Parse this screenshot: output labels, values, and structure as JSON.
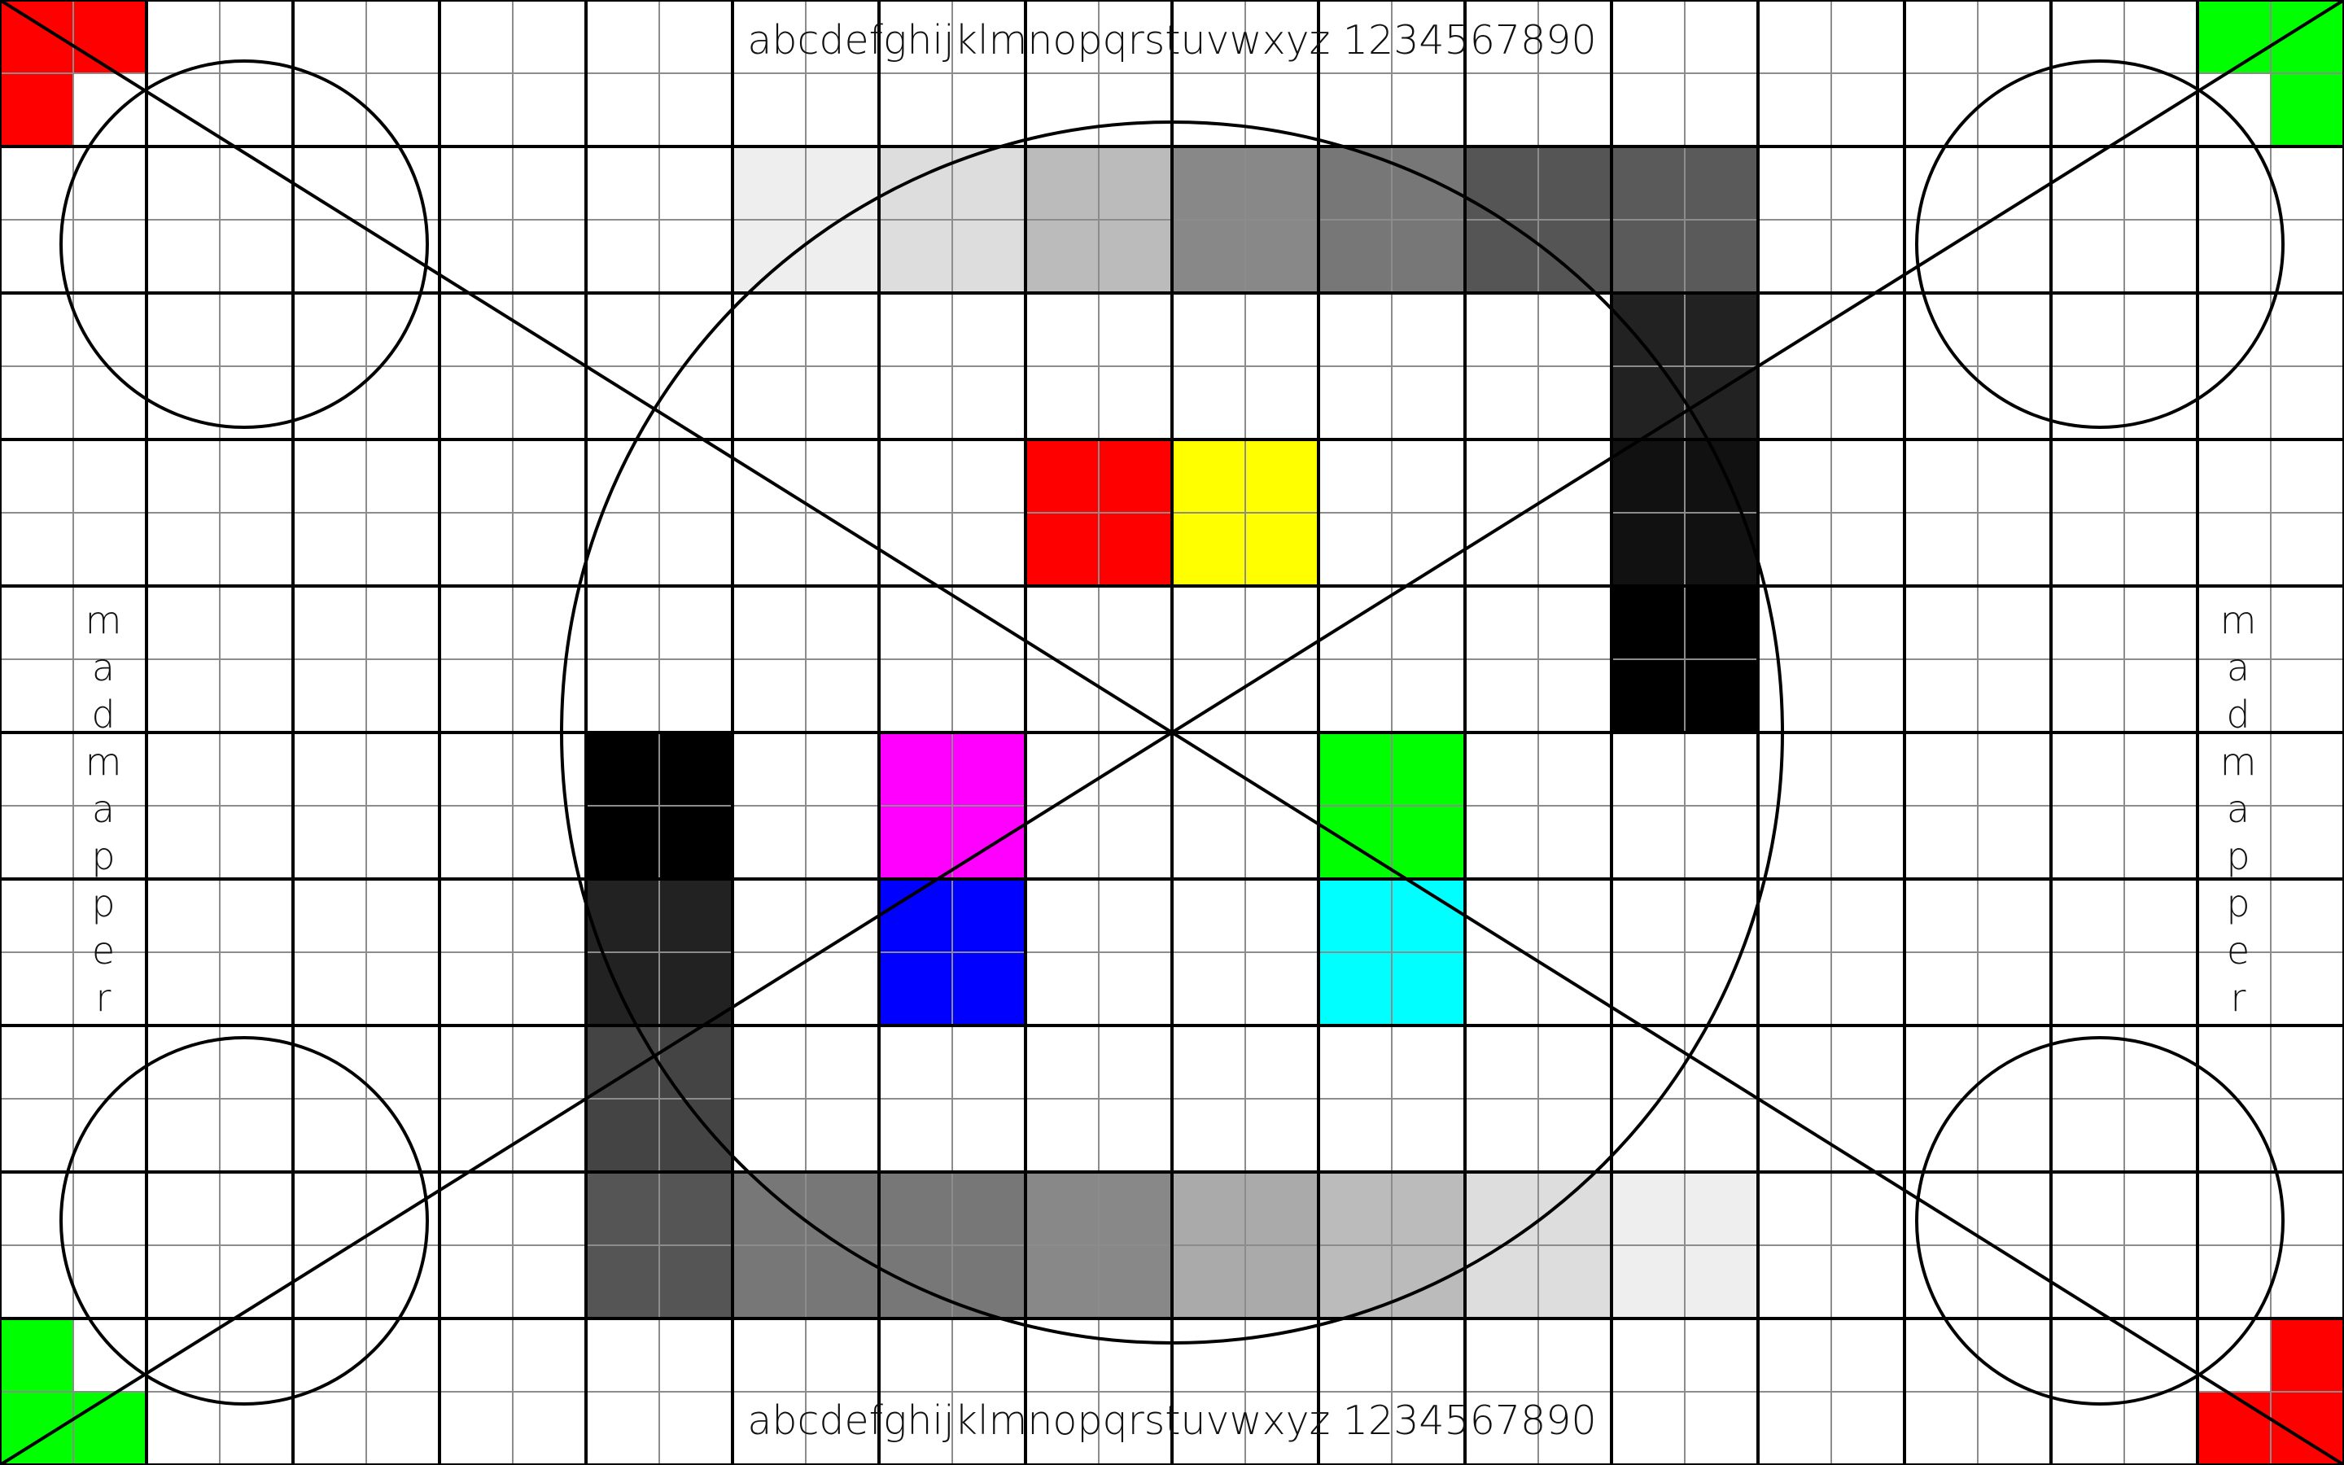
{
  "app": {
    "name": "madmapper"
  },
  "colors": {
    "background": "#ffffff",
    "grid_major": "#000000",
    "grid_minor": "#8c8c8c",
    "red": "#ff0000",
    "yellow": "#ffff00",
    "magenta": "#ff00ff",
    "green": "#00ff00",
    "blue": "#0000ff",
    "cyan": "#00ffff",
    "black": "#000000"
  },
  "text": {
    "top_line": "abcdefghijklmnopqrstuvwxyz 1234567890",
    "bottom_line": "abcdefghijklmnopqrstuvwxyz 1234567890",
    "left_vertical": "madmapper",
    "right_vertical": "madmapper"
  },
  "grayscale_ramps": {
    "top": [
      "#eeeeee",
      "#dddddd",
      "#bbbbbb",
      "#888888",
      "#777777",
      "#555555",
      "#5a5a5a"
    ],
    "right": [
      "#222222",
      "#111111",
      "#000000"
    ],
    "left": [
      "#000000",
      "#222222",
      "#444444"
    ],
    "bottom": [
      "#555555",
      "#777777",
      "#777777",
      "#888888",
      "#aaaaaa",
      "#bbbbbb",
      "#dddddd",
      "#eeeeee"
    ]
  },
  "color_swatches": [
    {
      "name": "red",
      "color": "#ff0000"
    },
    {
      "name": "yellow",
      "color": "#ffff00"
    },
    {
      "name": "magenta",
      "color": "#ff00ff"
    },
    {
      "name": "green",
      "color": "#00ff00"
    },
    {
      "name": "blue",
      "color": "#0000ff"
    },
    {
      "name": "cyan",
      "color": "#00ffff"
    }
  ],
  "corner_markers": {
    "top_left": "#ff0000",
    "top_right": "#00ff00",
    "bottom_left": "#00ff00",
    "bottom_right": "#ff0000"
  }
}
